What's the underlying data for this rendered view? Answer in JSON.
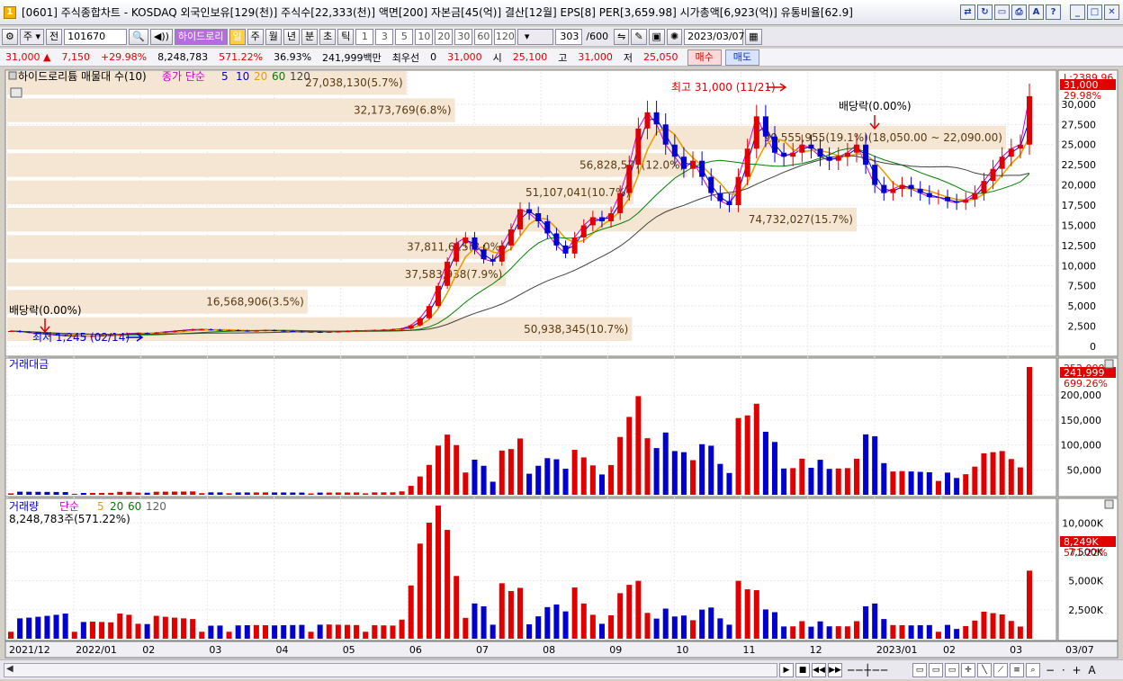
{
  "window": {
    "title": "[0601] 주식종합차트 - KOSDAQ 외국인보유[129(천)] 주식수[22,333(천)] 액면[200] 자본금[45(억)] 결산[12월] EPS[8] PER[3,659.98] 시가총액[6,923(억)] 유통비율[62.9]",
    "icon_label": "1"
  },
  "toolbar": {
    "period": "주",
    "prev_label": "전",
    "code": "101670",
    "stock_name": "하이드로리",
    "period_buttons": [
      "일",
      "주",
      "월",
      "년",
      "분",
      "초",
      "틱"
    ],
    "minute_buttons": [
      "1",
      "3",
      "5",
      "10",
      "20",
      "30",
      "60",
      "120"
    ],
    "count": "303",
    "count_max": "/600",
    "date": "2023/03/07"
  },
  "quote": {
    "price": "31,000",
    "change": "7,150",
    "change_pct": "+29.98%",
    "volume": "8,248,783",
    "volume_ratio": "571.22%",
    "turnover": "36.93%",
    "amount": "241,999백만",
    "preferred_label": "최우선",
    "preferred_value": "0",
    "best_price": "31,000",
    "open_label": "시",
    "open": "25,100",
    "high_label": "고",
    "high": "31,000",
    "low_label": "저",
    "low": "25,050",
    "buy_label": "매수",
    "sell_label": "매도"
  },
  "panels": {
    "price": {
      "legend_profile": "하이드로리튬 매물대 수(10)",
      "legend_ma": "종가 단순",
      "ma_periods": [
        "5",
        "10",
        "20",
        "60",
        "120"
      ],
      "ma_colors": [
        "#d000d0",
        "#0000d0",
        "#e8a000",
        "#008000",
        "#404040"
      ],
      "annotation_high": "최고 31,000 (11/21)",
      "annotation_low": "최저 1,245 (02/14)",
      "annotation_dividend1": "배당락(0.00%)",
      "annotation_dividend2": "배당락(0.00%)",
      "scale_top": "L:2389.96",
      "last_value": "31,000",
      "last_pct": "29.98%"
    },
    "amount": {
      "legend": "거래대금",
      "last_value": "241,999",
      "last_pct": "699.26%",
      "scale_top": "252,000"
    },
    "volume": {
      "legend": "거래량",
      "legend_ma": "단순",
      "ma_periods": [
        "5",
        "20",
        "60",
        "120"
      ],
      "info": "8,248,783주(571.22%)",
      "last_value": "8,249K",
      "last_pct": "571.22%"
    }
  },
  "chart_data": [
    {
      "type": "candlestick",
      "title": "하이드로리튬",
      "y_ticks": [
        0,
        2500,
        5000,
        7500,
        10000,
        12500,
        15000,
        17500,
        20000,
        22500,
        25000,
        27500,
        30000
      ],
      "y_tick_labels": [
        "0",
        "2,500",
        "5,000",
        "7,500",
        "10,000",
        "12,500",
        "15,000",
        "17,500",
        "20,000",
        "22,500",
        "25,000",
        "27,500",
        "30,000"
      ],
      "ylim": [
        -1000,
        34000
      ],
      "x_labels": [
        "2021/12",
        "2022/01",
        "02",
        "03",
        "04",
        "05",
        "06",
        "07",
        "08",
        "09",
        "10",
        "11",
        "12",
        "2023/01",
        "02",
        "03",
        "03/07"
      ],
      "close_series": [
        1900,
        1800,
        1700,
        1600,
        1500,
        1400,
        1300,
        1300,
        1250,
        1300,
        1350,
        1400,
        1500,
        1600,
        1650,
        1600,
        1700,
        1800,
        1900,
        2000,
        2100,
        2100,
        2050,
        2000,
        2000,
        1950,
        1900,
        1950,
        2000,
        1950,
        1900,
        1850,
        1800,
        1800,
        1750,
        1800,
        1850,
        1900,
        1950,
        1950,
        2000,
        2050,
        2100,
        2200,
        2600,
        3500,
        5000,
        7500,
        10500,
        12800,
        13500,
        12000,
        10800,
        10500,
        12500,
        14500,
        17000,
        16500,
        15500,
        14000,
        12500,
        11500,
        13500,
        15000,
        16000,
        15500,
        16500,
        19000,
        22500,
        27000,
        29000,
        27500,
        25000,
        23500,
        22000,
        23000,
        21000,
        19000,
        18000,
        17500,
        21000,
        24500,
        28500,
        26000,
        24000,
        23500,
        24000,
        25000,
        24500,
        23500,
        23000,
        23500,
        24000,
        25000,
        22500,
        20000,
        19000,
        19500,
        20000,
        19500,
        19000,
        18500,
        18500,
        18000,
        17800,
        18200,
        19000,
        20500,
        22000,
        23500,
        24500,
        25000,
        31000
      ],
      "volume_profile": [
        {
          "label": "50,938,345(10.7%)",
          "value": 50938345
        },
        {
          "label": "16,568,906(3.5%)",
          "value": 16568906
        },
        {
          "label": "37,583,938(7.9%)",
          "value": 37583938
        },
        {
          "label": "37,811,615(8.0%)",
          "value": 37811615
        },
        {
          "label": "74,732,027(15.7%)",
          "value": 74732027
        },
        {
          "label": "51,107,041(10.7%)",
          "value": 51107041
        },
        {
          "label": "56,828,577(12.0%)",
          "value": 56828577
        },
        {
          "label": "90,555,955(19.1%)(18,050.00 ~ 22,090.00)",
          "value": 90555955
        },
        {
          "label": "32,173,769(6.8%)",
          "value": 32173769
        },
        {
          "label": "27,038,130(5.7%)",
          "value": 27038130
        }
      ]
    },
    {
      "type": "bar",
      "title": "거래대금",
      "y_ticks": [
        50000,
        100000,
        150000,
        200000
      ],
      "y_tick_labels": [
        "50,000",
        "100,000",
        "150,000",
        "200,000"
      ],
      "ylim": [
        0,
        260000
      ]
    },
    {
      "type": "bar",
      "title": "거래량",
      "y_ticks": [
        2500,
        5000,
        7500,
        10000
      ],
      "y_tick_labels": [
        "2,500K",
        "5,000K",
        "7,500K",
        "10,000K"
      ],
      "ylim": [
        0,
        11500
      ]
    }
  ],
  "bottom": {
    "zoom_label": "− · + A"
  }
}
